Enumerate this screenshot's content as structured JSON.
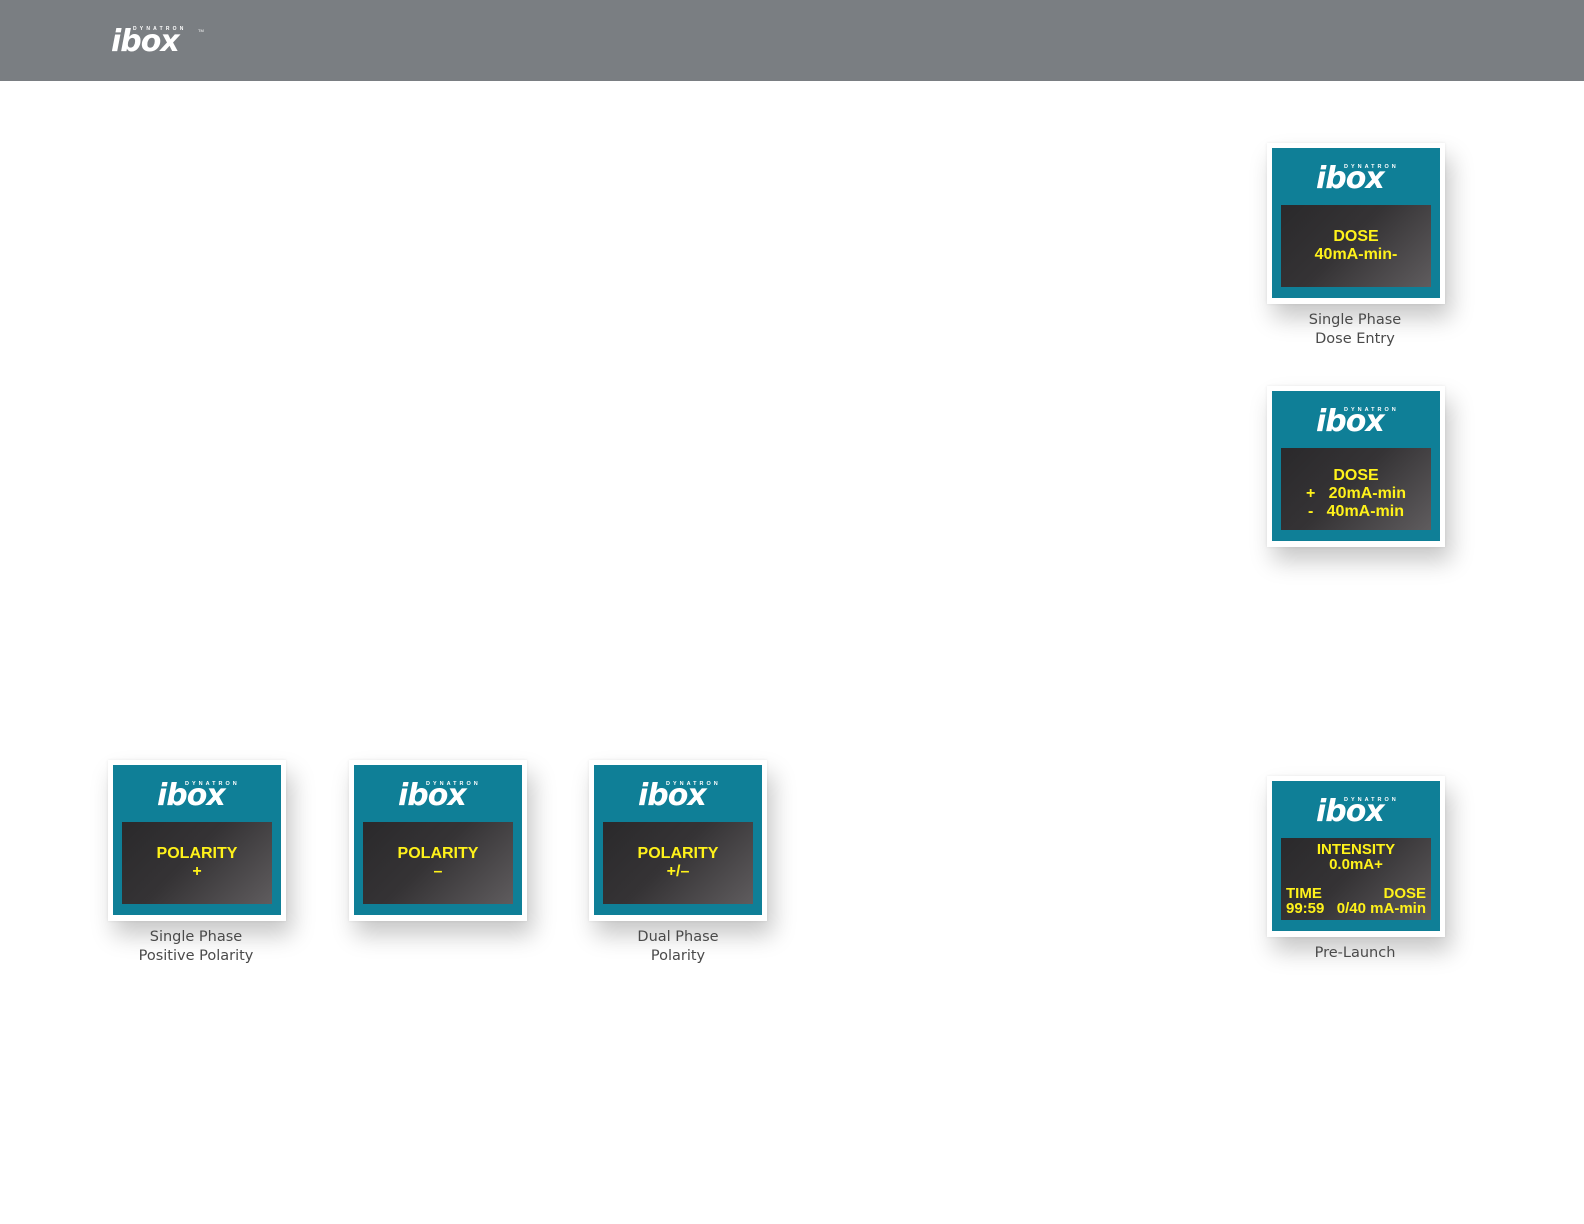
{
  "header": {
    "brand": {
      "superscript": "DYNATRON",
      "word": "ibox",
      "tm": "TM"
    }
  },
  "panels": {
    "dose_single": {
      "logo": {
        "superscript": "DYNATRON",
        "word": "ibox"
      },
      "lines": [
        "DOSE",
        "40mA-min-"
      ],
      "caption": [
        "Single Phase",
        "Dose Entry"
      ]
    },
    "dose_dual": {
      "logo": {
        "superscript": "DYNATRON",
        "word": "ibox"
      },
      "lines": [
        "DOSE",
        "+   20mA-min",
        "-   40mA-min"
      ]
    },
    "polarity_positive": {
      "logo": {
        "superscript": "DYNATRON",
        "word": "ibox"
      },
      "lines": [
        "POLARITY",
        "+"
      ],
      "caption": [
        "Single Phase",
        "Positive Polarity"
      ]
    },
    "polarity_negative": {
      "logo": {
        "superscript": "DYNATRON",
        "word": "ibox"
      },
      "lines": [
        "POLARITY",
        "–"
      ]
    },
    "polarity_dual": {
      "logo": {
        "superscript": "DYNATRON",
        "word": "ibox"
      },
      "lines": [
        "POLARITY",
        "+/–"
      ],
      "caption": [
        "Dual Phase",
        "Polarity"
      ]
    },
    "pre_launch": {
      "logo": {
        "superscript": "DYNATRON",
        "word": "ibox"
      },
      "intensity_label": "INTENSITY",
      "intensity_value": "0.0mA+",
      "time_label": "TIME",
      "time_value": "99:59",
      "dose_label": "DOSE",
      "dose_value": "0/40 mA-min",
      "caption": [
        "Pre-Launch"
      ]
    }
  },
  "colors": {
    "header_bar": "#7a7e82",
    "screen_teal": "#0f7f97",
    "lcd_text": "#fff21a",
    "caption_text": "#4a4a4a"
  }
}
